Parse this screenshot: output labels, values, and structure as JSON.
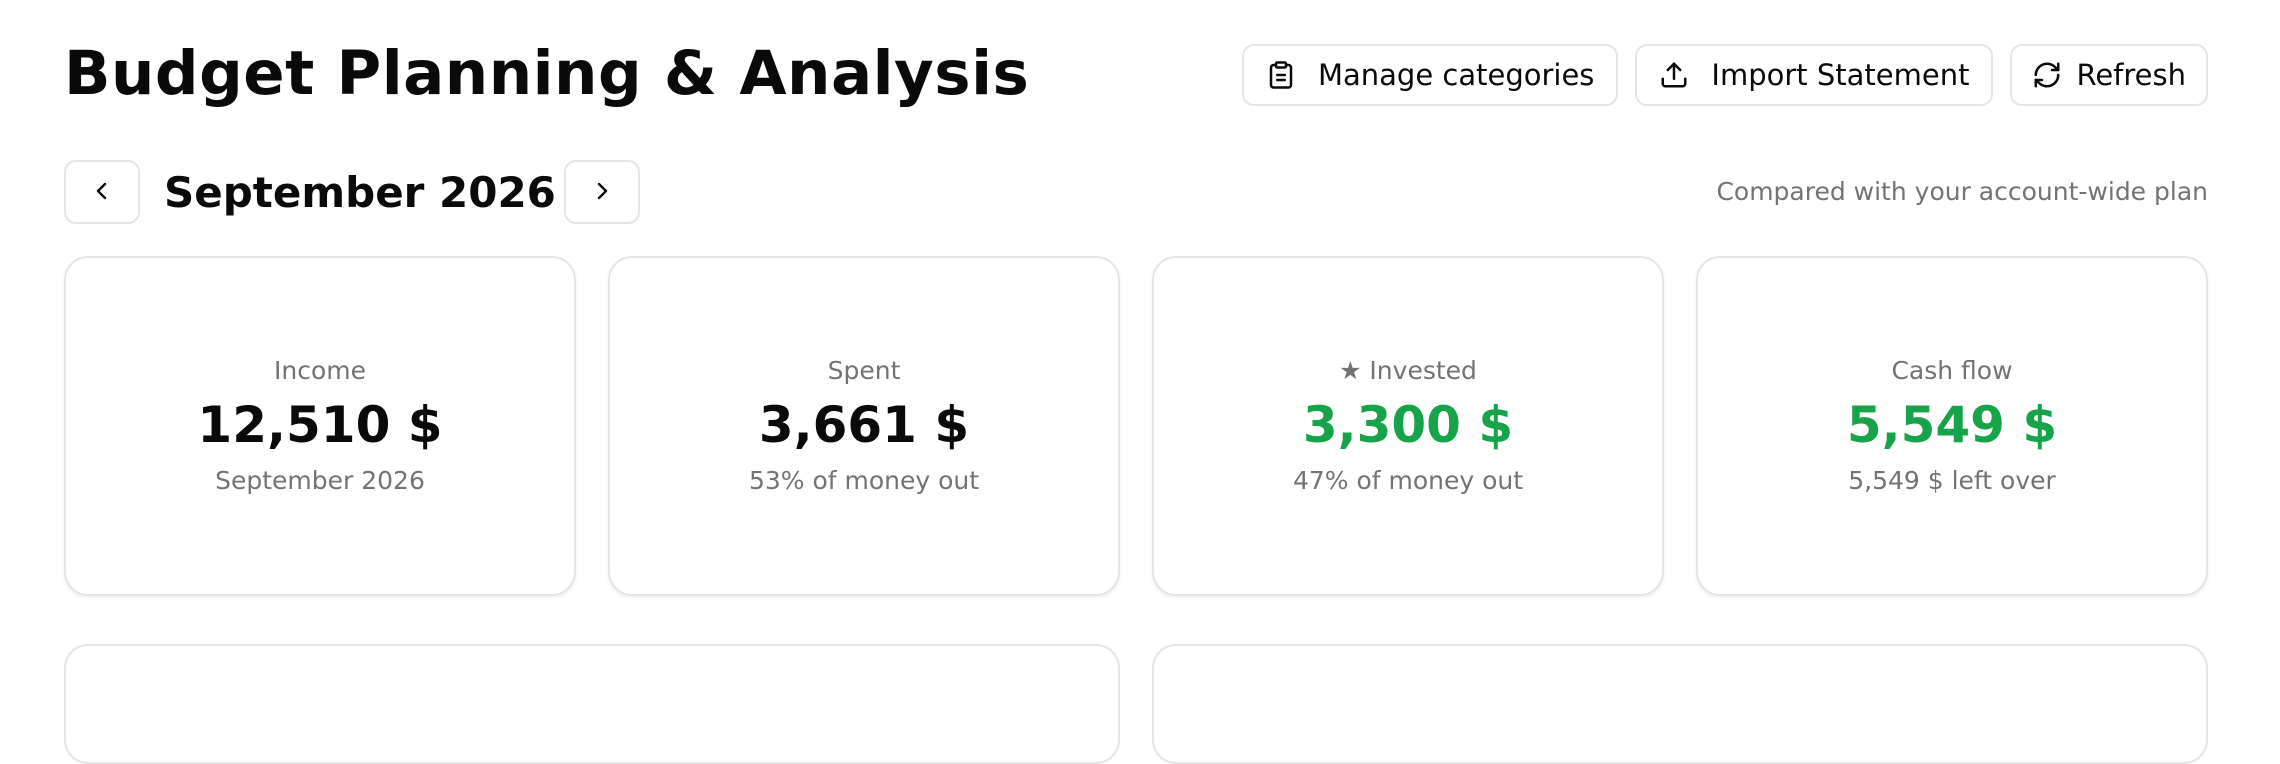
{
  "header": {
    "title": "Budget Planning & Analysis",
    "actions": {
      "manage_categories": {
        "label": "Manage categories",
        "icon": "clipboard-icon"
      },
      "import_statement": {
        "label": "Import Statement",
        "icon": "upload-icon"
      },
      "refresh": {
        "label": "Refresh",
        "icon": "refresh-icon"
      }
    }
  },
  "period": {
    "label": "September 2026",
    "prev_icon": "chevron-left-icon",
    "next_icon": "chevron-right-icon",
    "compare_note": "Compared with your account-wide plan"
  },
  "cards": [
    {
      "label": "Income",
      "value": "12,510 $",
      "sub": "September 2026",
      "value_color": "#0a0a0a"
    },
    {
      "label": "Spent",
      "value": "3,661 $",
      "sub": "53% of money out",
      "value_color": "#0a0a0a"
    },
    {
      "label": "★ Invested",
      "value": "3,300 $",
      "sub": "47% of money out",
      "value_color": "#16a34a"
    },
    {
      "label": "Cash flow",
      "value": "5,549 $",
      "sub": "5,549 $ left over",
      "value_color": "#16a34a"
    }
  ],
  "colors": {
    "positive": "#16a34a",
    "muted_text": "#737373",
    "border": "#e5e5e5"
  }
}
